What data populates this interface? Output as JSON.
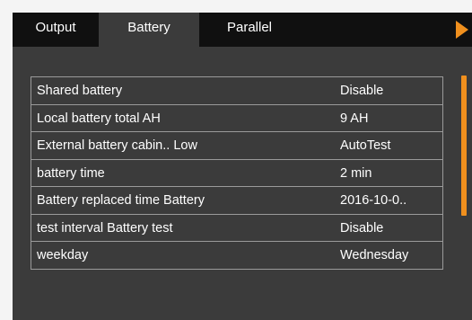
{
  "tabs": [
    {
      "label": "Output"
    },
    {
      "label": "Battery"
    },
    {
      "label": "Parallel"
    }
  ],
  "active_tab": "Battery",
  "accent_color": "#f0901e",
  "tabbar_color": "#101010",
  "panel_color": "#3b3b3b",
  "icons": {
    "next_tab": "play-arrow-icon"
  },
  "settings": [
    {
      "label": "Shared battery",
      "value": "Disable"
    },
    {
      "label": "Local battery total AH",
      "value": "9 AH"
    },
    {
      "label": "External battery cabin.. Low",
      "value": "AutoTest"
    },
    {
      "label": "battery time",
      "value": "2 min"
    },
    {
      "label": "Battery replaced time Battery",
      "value": "2016-10-0.."
    },
    {
      "label": "test interval Battery test",
      "value": "Disable"
    },
    {
      "label": "weekday",
      "value": "Wednesday"
    }
  ]
}
